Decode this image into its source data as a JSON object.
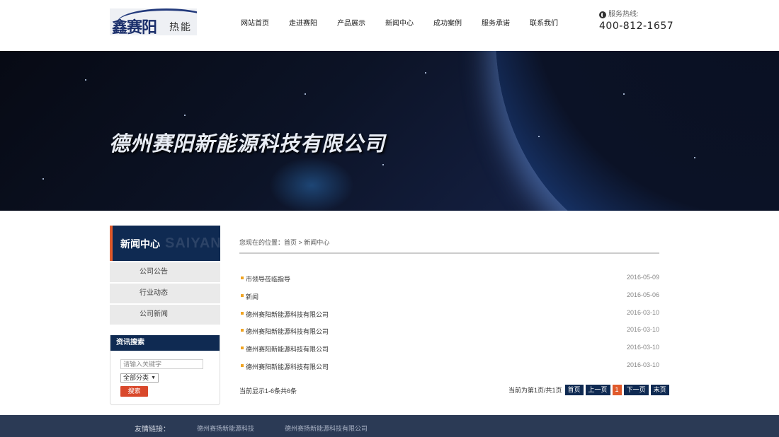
{
  "header": {
    "logo_main": "鑫赛阳",
    "logo_sub": "热能",
    "nav": [
      "网站首页",
      "走进赛阳",
      "产品展示",
      "新闻中心",
      "成功案例",
      "服务承诺",
      "联系我们"
    ],
    "hotline_label": "服务热线:",
    "hotline_number": "400-812-1657"
  },
  "banner": {
    "title": "德州赛阳新能源科技有限公司"
  },
  "sidebar": {
    "title": "新闻中心",
    "watermark": "SAIYANG",
    "items": [
      "公司公告",
      "行业动态",
      "公司新闻"
    ]
  },
  "search": {
    "title": "资讯搜索",
    "placeholder": "请输入关键字",
    "category": "全部分类",
    "button": "搜索"
  },
  "breadcrumb": "您现在的位置：首页 > 新闻中心",
  "news": [
    {
      "title": "市领导莅临指导",
      "date": "2016-05-09"
    },
    {
      "title": "新闻",
      "date": "2016-05-06"
    },
    {
      "title": "德州赛阳新能源科技有限公司",
      "date": "2016-03-10"
    },
    {
      "title": "德州赛阳新能源科技有限公司",
      "date": "2016-03-10"
    },
    {
      "title": "德州赛阳新能源科技有限公司",
      "date": "2016-03-10"
    },
    {
      "title": "德州赛阳新能源科技有限公司",
      "date": "2016-03-10"
    }
  ],
  "pager": {
    "info": "当前显示1-6条共6条",
    "page_text": "当前为第1页/共1页",
    "first": "首页",
    "prev": "上一页",
    "current": "1",
    "next": "下一页",
    "last": "末页"
  },
  "footer": {
    "label": "友情链接：",
    "links": [
      "德州赛扬新能源科技",
      "德州赛扬新能源科技有限公司"
    ]
  },
  "colors": {
    "navy": "#0f2a52",
    "accent_orange": "#e05a2b",
    "bullet": "#f0a422",
    "footer": "#2b3a55"
  }
}
